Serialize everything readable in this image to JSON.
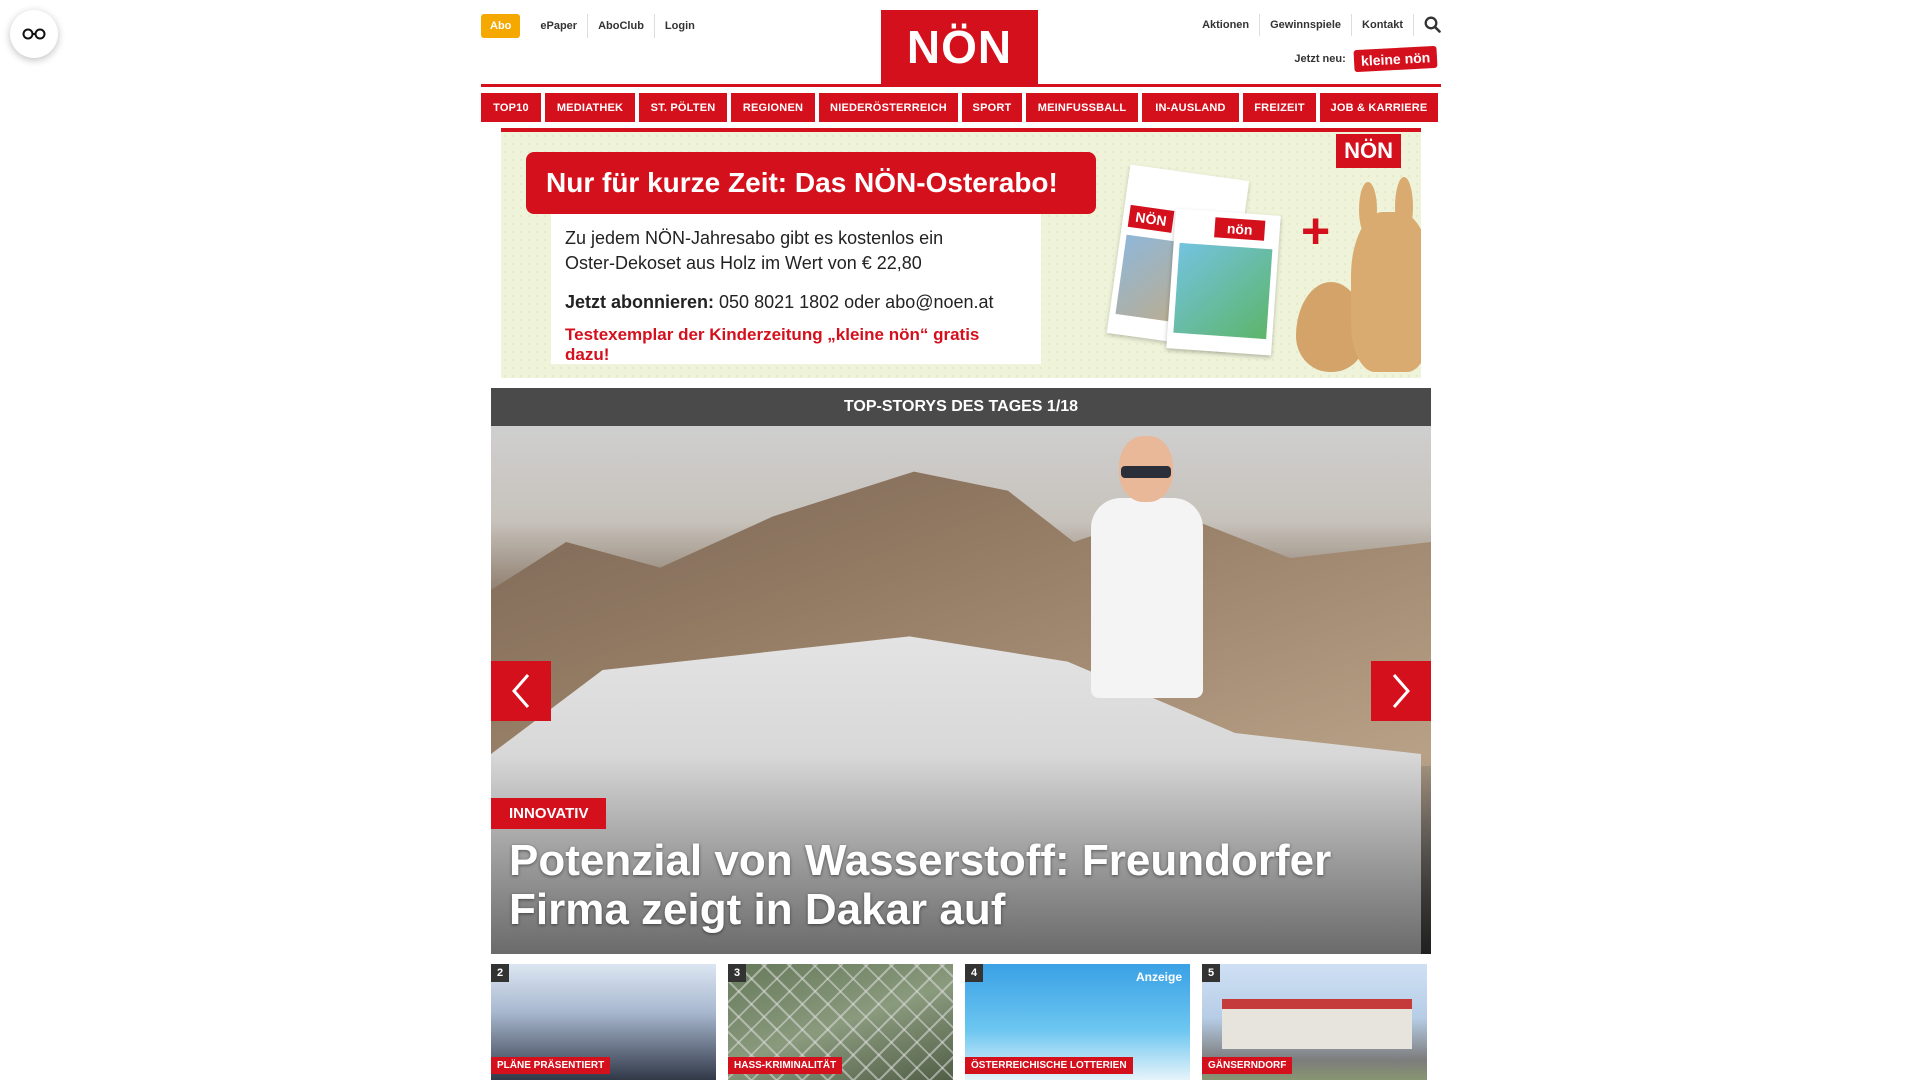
{
  "header": {
    "abo_label": "Abo",
    "links_left": [
      "ePaper",
      "AboClub",
      "Login"
    ],
    "logo": "NÖN",
    "links_right": [
      "Aktionen",
      "Gewinnspiele",
      "Kontakt"
    ],
    "neu_label": "Jetzt neu:",
    "neu_badge": "kleine nön"
  },
  "nav": {
    "items": [
      "TOP10",
      "MEDIATHEK",
      "ST. PÖLTEN",
      "REGIONEN",
      "NIEDERÖSTERREICH",
      "SPORT",
      "MEINFUSSBALL",
      "IN-AUSLAND",
      "FREIZEIT",
      "JOB & KARRIERE"
    ]
  },
  "banner": {
    "headline": "Nur für kurze Zeit: Das NÖN-Osterabo!",
    "text_line1": "Zu jedem NÖN-Jahresabo gibt es kostenlos ein",
    "text_line2": "Oster-Dekoset aus Holz im Wert von € 22,80",
    "cta_bold": "Jetzt abonnieren:",
    "cta_rest": " 050 8021 1802 oder abo@noen.at",
    "promo": "Testexemplar der Kinderzeitung „kleine nön“ gratis dazu!",
    "tag": "NÖN",
    "mag1_label": "NÖN",
    "mag2_label": "nön"
  },
  "stories": {
    "bar_title": "TOP-STORYS DES TAGES 1/18",
    "hero": {
      "category": "INNOVATIV",
      "title": "Potenzial von Wasserstoff: Freundorfer Firma zeigt in Dakar auf"
    },
    "thumbs": [
      {
        "num": "2",
        "tag": "PLÄNE PRÄSENTIERT",
        "ad": ""
      },
      {
        "num": "3",
        "tag": "HASS-KRIMINALITÄT",
        "ad": ""
      },
      {
        "num": "4",
        "tag": "ÖSTERREICHISCHE LOTTERIEN",
        "ad": "Anzeige"
      },
      {
        "num": "5",
        "tag": "GÄNSERNDORF",
        "ad": ""
      }
    ]
  },
  "colors": {
    "brand_red": "#d5101d",
    "abo_orange": "#f5a800",
    "story_bar": "#4a4a4a"
  },
  "icons": [
    "accessibility-glasses-icon",
    "search-icon",
    "chevron-left-icon",
    "chevron-right-icon"
  ]
}
